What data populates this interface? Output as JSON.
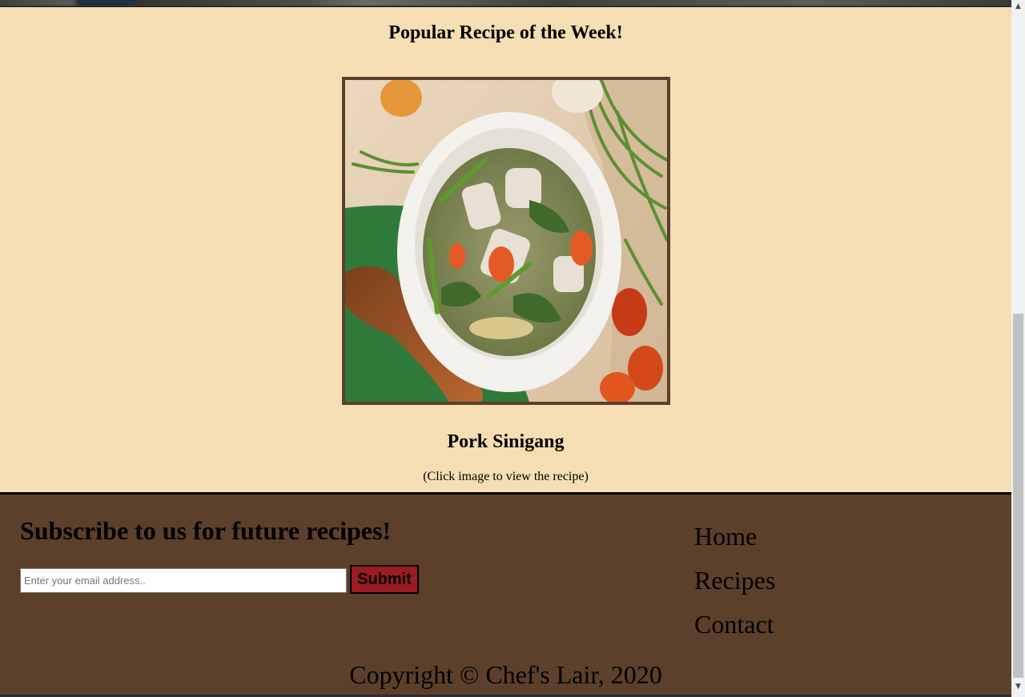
{
  "featured": {
    "title": "Popular Recipe of the Week!",
    "recipe_name": "Pork Sinigang",
    "hint": "(Click image to view the recipe)",
    "image_icon": "soup-bowl-photo"
  },
  "footer": {
    "subscribe_title": "Subscribe to us for future recipes!",
    "email_placeholder": "Enter your email address..",
    "email_value": "",
    "submit_label": "Submit",
    "nav": [
      {
        "label": "Home"
      },
      {
        "label": "Recipes"
      },
      {
        "label": "Contact"
      }
    ],
    "copyright": "Copyright © Chef's Lair, 2020"
  },
  "colors": {
    "background": "#f5deb3",
    "footer": "#5c402b",
    "image_border": "#5a3f2b",
    "submit": "#9b1c24"
  }
}
